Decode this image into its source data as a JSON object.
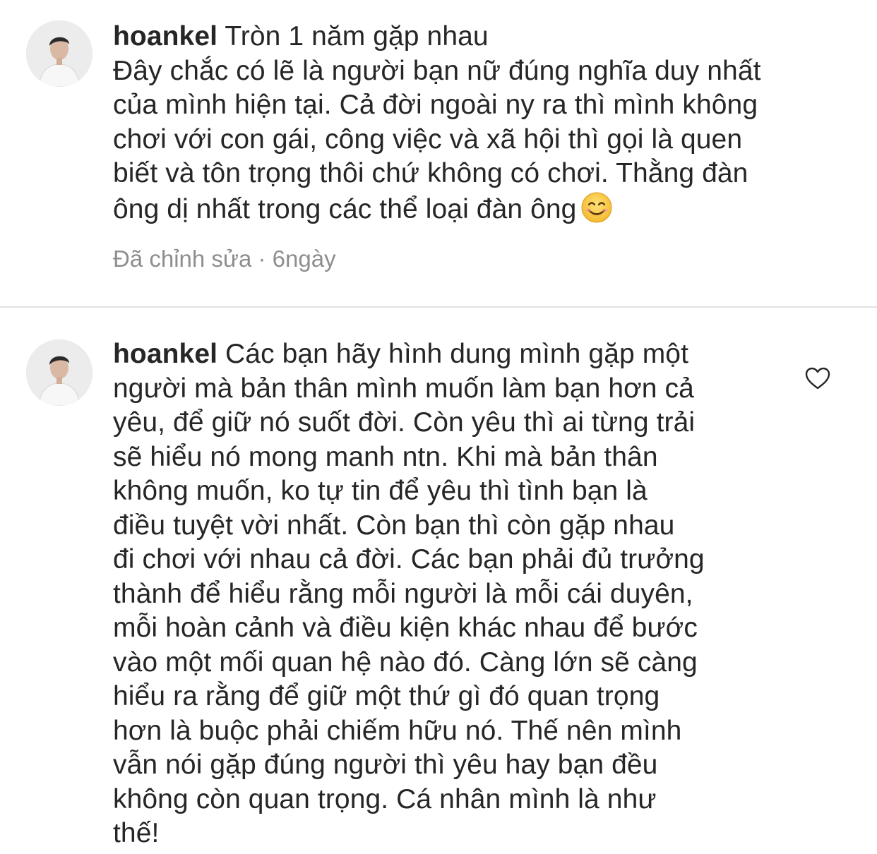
{
  "comments": [
    {
      "username": "hoankel",
      "lines": [
        "Tròn 1 năm gặp nhau",
        "Đây chắc có lẽ là người bạn nữ đúng nghĩa duy nhất",
        "của mình hiện tại. Cả đời ngoài ny ra thì mình không",
        "chơi với con gái, công việc và xã hội thì gọi là quen",
        "biết và tôn trọng thôi chứ không có chơi. Thằng đàn",
        "ông dị nhất trong các thể loại đàn ông"
      ],
      "emoji_icon": "smiling-face-icon",
      "meta": "Đã chỉnh sửa · 6ngày"
    },
    {
      "username": "hoankel",
      "lines": [
        "Các bạn hãy hình dung mình gặp một",
        "người mà bản thân mình muốn làm bạn hơn cả",
        "yêu, để giữ nó suốt đời. Còn yêu thì ai từng trải",
        "sẽ hiểu nó mong manh ntn. Khi mà bản thân",
        "không muốn, ko tự tin để yêu thì tình bạn là",
        "điều tuyệt vời nhất. Còn bạn thì còn gặp nhau",
        "đi chơi với nhau cả đời. Các bạn phải đủ trưởng",
        "thành để hiểu rằng mỗi người là mỗi cái duyên,",
        "mỗi hoàn cảnh và điều kiện khác nhau để bước",
        "vào một mối quan hệ nào đó. Càng lớn sẽ càng",
        "hiểu ra rằng để giữ một thứ gì đó quan trọng",
        "hơn là buộc phải chiếm hữu nó. Thế nên mình",
        "vẫn nói gặp đúng người thì yêu hay bạn đều",
        "không còn quan trọng. Cá nhân mình là như",
        "thế!"
      ],
      "like_icon": "heart-outline-icon"
    }
  ],
  "colors": {
    "text": "#262626",
    "meta": "#8e8e8e",
    "divider": "#e3e3e3"
  }
}
